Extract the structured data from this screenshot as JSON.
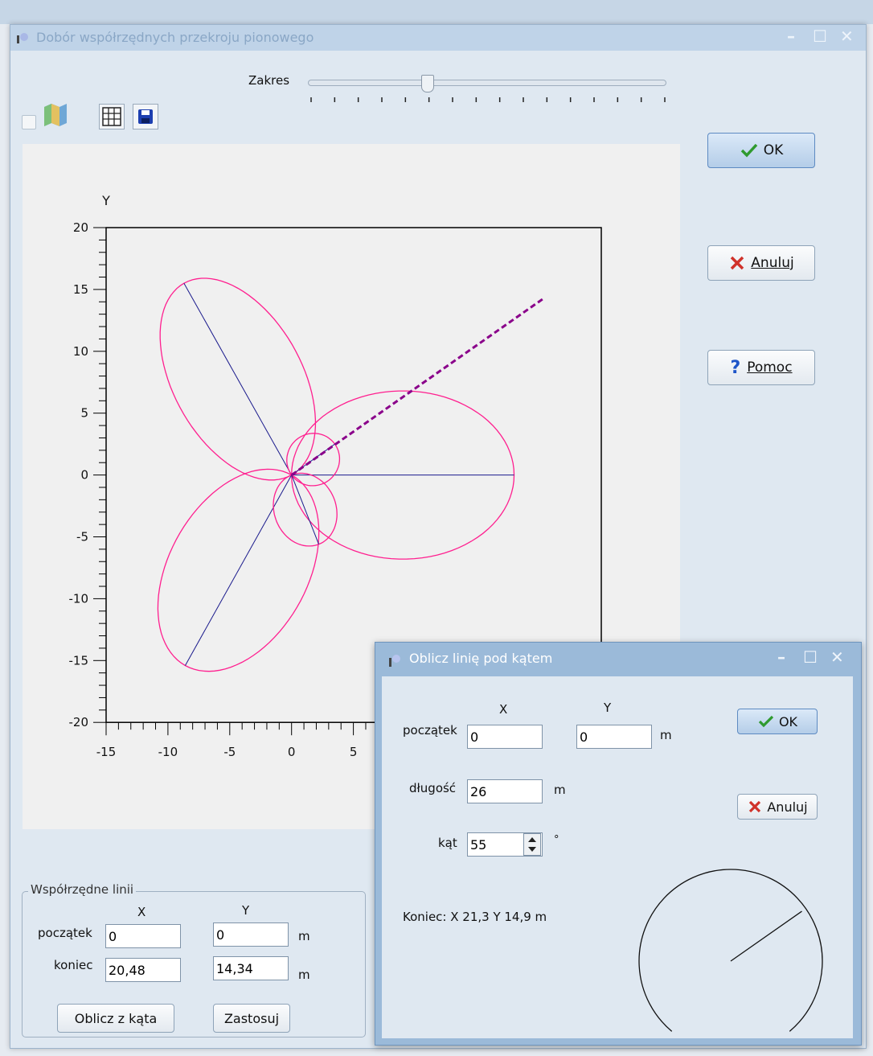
{
  "main_window": {
    "title": "Dobór współrzędnych przekroju pionowego",
    "controls": {
      "minimize": "–",
      "maximize": "☐",
      "close": "✕"
    }
  },
  "range": {
    "label": "Zakres",
    "ticks": 16,
    "value_fraction": 0.34
  },
  "toolbar": {
    "icons": [
      "map-icon",
      "grid-icon",
      "save-icon"
    ]
  },
  "buttons": {
    "ok": "OK",
    "cancel": "Anuluj",
    "help": "Pomoc"
  },
  "chart_data": {
    "type": "polar-lobes",
    "ylabel": "Y",
    "xlabel": "",
    "xlim": [
      -15,
      25
    ],
    "ylim": [
      -20,
      20
    ],
    "x_ticks": [
      "-15",
      "-10",
      "-5",
      "0",
      "5"
    ],
    "y_ticks": [
      "20",
      "15",
      "10",
      "5",
      "0",
      "-5",
      "-10",
      "-15",
      "-20"
    ],
    "lobe_color": "#ff1f8f",
    "axis_line_color": "#1a1a8c",
    "section_line_color": "#8a008a",
    "lobes": [
      {
        "tip": [
          -8.7,
          15.5
        ],
        "half_width": 5.2
      },
      {
        "tip": [
          18.0,
          0.0
        ],
        "half_width": 6.8
      },
      {
        "tip": [
          -8.6,
          -15.4
        ],
        "half_width": 5.6
      },
      {
        "tip": [
          3.5,
          2.5
        ],
        "half_width": 2.1
      },
      {
        "tip": [
          2.2,
          -5.6
        ],
        "half_width": 2.5
      }
    ],
    "section_line": {
      "start": [
        0,
        0
      ],
      "end": [
        20.48,
        14.34
      ]
    }
  },
  "coords_group": {
    "title": "Współrzędne linii",
    "col_x": "X",
    "col_y": "Y",
    "start_label": "początek",
    "end_label": "koniec",
    "start_x": "0",
    "start_y": "0",
    "end_x": "20,48",
    "end_y": "14,34",
    "unit": "m",
    "calc_button": "Oblicz z kąta",
    "apply_button": "Zastosuj"
  },
  "dialog": {
    "title": "Oblicz linię pod kątem",
    "col_x": "X",
    "col_y": "Y",
    "start_label": "początek",
    "start_x": "0",
    "start_y": "0",
    "unit": "m",
    "length_label": "długość",
    "length_value": "26",
    "angle_label": "kąt",
    "angle_value": "55",
    "angle_unit": "°",
    "result": "Koniec: X 21,3 Y 14,9 m",
    "ok": "OK",
    "cancel": "Anuluj",
    "angle_deg": 55
  }
}
